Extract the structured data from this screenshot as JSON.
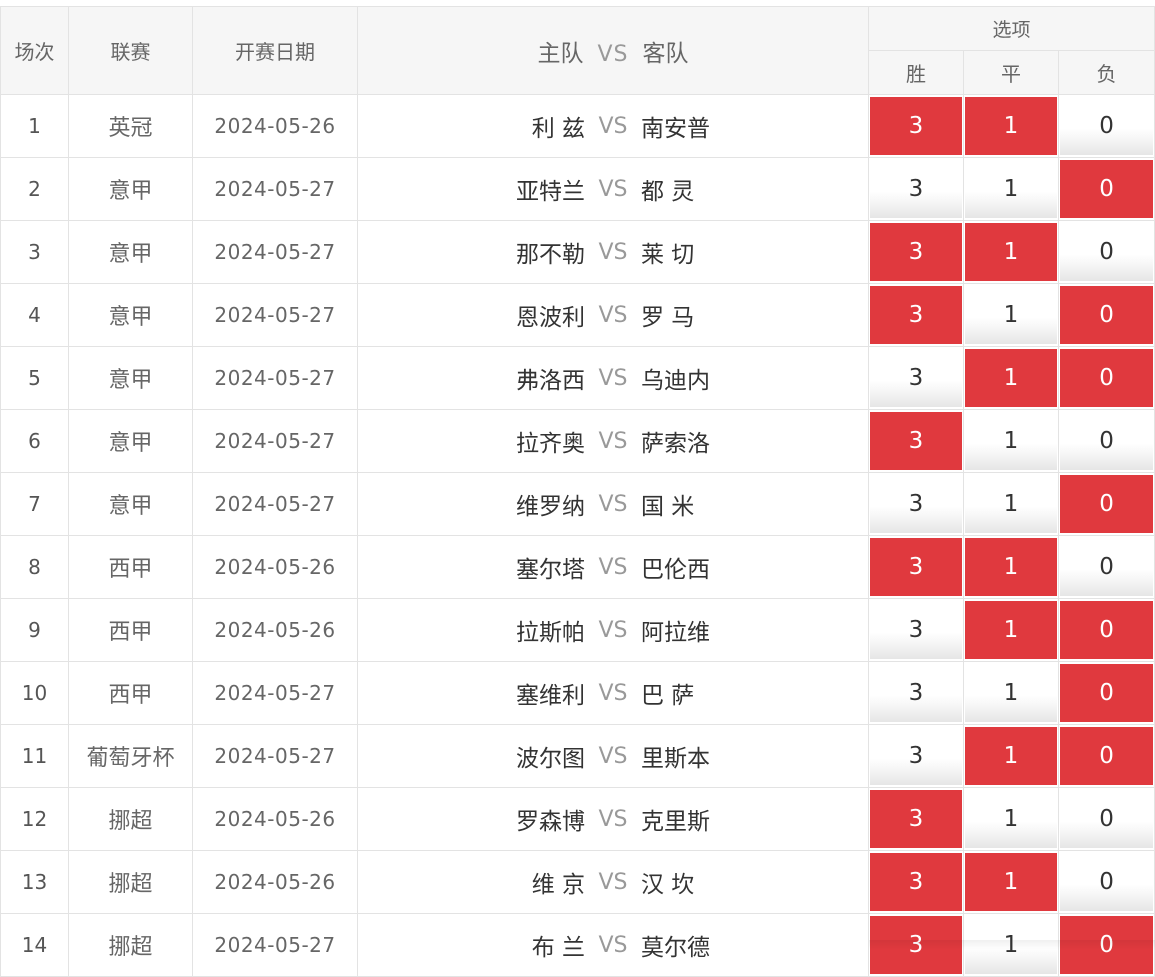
{
  "header": {
    "col_index": "场次",
    "col_league": "联赛",
    "col_date": "开赛日期",
    "col_home": "主队",
    "col_vs": "VS",
    "col_away": "客队",
    "col_options": "选项",
    "opt_win": "胜",
    "opt_draw": "平",
    "opt_lose": "负"
  },
  "colors": {
    "selected": "#e0393e",
    "border": "#e3e3e3",
    "header_bg": "#f6f6f6"
  },
  "rows": [
    {
      "no": "1",
      "league": "英冠",
      "date": "2024-05-26",
      "home": "利 兹",
      "vs": "VS",
      "away": "南安普",
      "win": "3",
      "draw": "1",
      "lose": "0",
      "sel": [
        true,
        true,
        false
      ]
    },
    {
      "no": "2",
      "league": "意甲",
      "date": "2024-05-27",
      "home": "亚特兰",
      "vs": "VS",
      "away": "都 灵",
      "win": "3",
      "draw": "1",
      "lose": "0",
      "sel": [
        false,
        false,
        true
      ]
    },
    {
      "no": "3",
      "league": "意甲",
      "date": "2024-05-27",
      "home": "那不勒",
      "vs": "VS",
      "away": "莱 切",
      "win": "3",
      "draw": "1",
      "lose": "0",
      "sel": [
        true,
        true,
        false
      ]
    },
    {
      "no": "4",
      "league": "意甲",
      "date": "2024-05-27",
      "home": "恩波利",
      "vs": "VS",
      "away": "罗 马",
      "win": "3",
      "draw": "1",
      "lose": "0",
      "sel": [
        true,
        false,
        true
      ]
    },
    {
      "no": "5",
      "league": "意甲",
      "date": "2024-05-27",
      "home": "弗洛西",
      "vs": "VS",
      "away": "乌迪内",
      "win": "3",
      "draw": "1",
      "lose": "0",
      "sel": [
        false,
        true,
        true
      ]
    },
    {
      "no": "6",
      "league": "意甲",
      "date": "2024-05-27",
      "home": "拉齐奥",
      "vs": "VS",
      "away": "萨索洛",
      "win": "3",
      "draw": "1",
      "lose": "0",
      "sel": [
        true,
        false,
        false
      ]
    },
    {
      "no": "7",
      "league": "意甲",
      "date": "2024-05-27",
      "home": "维罗纳",
      "vs": "VS",
      "away": "国 米",
      "win": "3",
      "draw": "1",
      "lose": "0",
      "sel": [
        false,
        false,
        true
      ]
    },
    {
      "no": "8",
      "league": "西甲",
      "date": "2024-05-26",
      "home": "塞尔塔",
      "vs": "VS",
      "away": "巴伦西",
      "win": "3",
      "draw": "1",
      "lose": "0",
      "sel": [
        true,
        true,
        false
      ]
    },
    {
      "no": "9",
      "league": "西甲",
      "date": "2024-05-26",
      "home": "拉斯帕",
      "vs": "VS",
      "away": "阿拉维",
      "win": "3",
      "draw": "1",
      "lose": "0",
      "sel": [
        false,
        true,
        true
      ]
    },
    {
      "no": "10",
      "league": "西甲",
      "date": "2024-05-27",
      "home": "塞维利",
      "vs": "VS",
      "away": "巴 萨",
      "win": "3",
      "draw": "1",
      "lose": "0",
      "sel": [
        false,
        false,
        true
      ]
    },
    {
      "no": "11",
      "league": "葡萄牙杯",
      "date": "2024-05-27",
      "home": "波尔图",
      "vs": "VS",
      "away": "里斯本",
      "win": "3",
      "draw": "1",
      "lose": "0",
      "sel": [
        false,
        true,
        true
      ]
    },
    {
      "no": "12",
      "league": "挪超",
      "date": "2024-05-26",
      "home": "罗森博",
      "vs": "VS",
      "away": "克里斯",
      "win": "3",
      "draw": "1",
      "lose": "0",
      "sel": [
        true,
        false,
        false
      ]
    },
    {
      "no": "13",
      "league": "挪超",
      "date": "2024-05-26",
      "home": "维 京",
      "vs": "VS",
      "away": "汉 坎",
      "win": "3",
      "draw": "1",
      "lose": "0",
      "sel": [
        true,
        true,
        false
      ]
    },
    {
      "no": "14",
      "league": "挪超",
      "date": "2024-05-27",
      "home": "布 兰",
      "vs": "VS",
      "away": "莫尔德",
      "win": "3",
      "draw": "1",
      "lose": "0",
      "sel": [
        true,
        false,
        true
      ]
    }
  ]
}
